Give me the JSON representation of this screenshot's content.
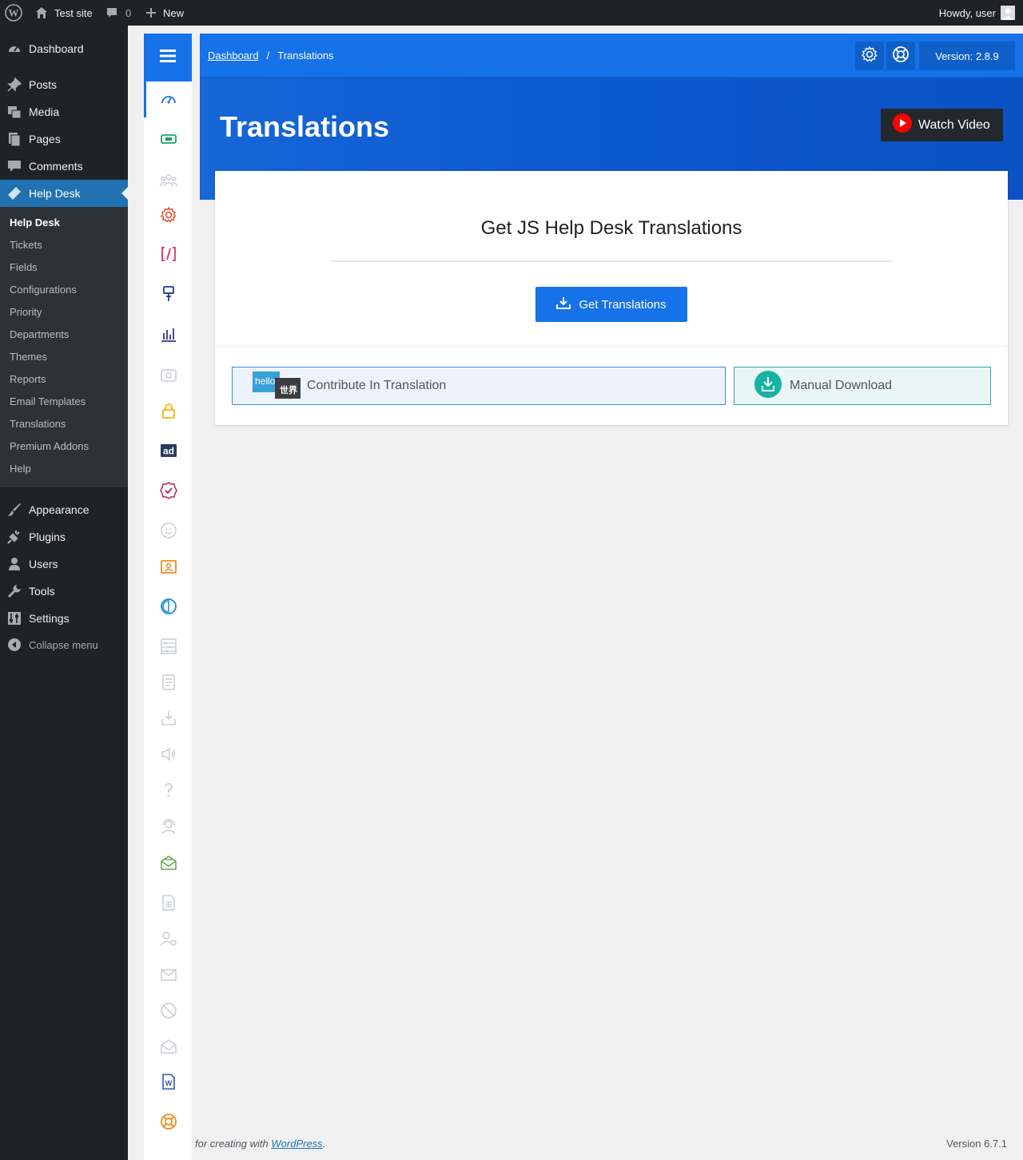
{
  "adminbar": {
    "site_name": "Test site",
    "comments_count": "0",
    "new_label": "New",
    "greeting": "Howdy, user"
  },
  "wp_menu": {
    "items": [
      {
        "label": "Dashboard",
        "icon": "dashboard-icon"
      },
      {
        "label": "Posts",
        "icon": "pin-icon"
      },
      {
        "label": "Media",
        "icon": "media-icon"
      },
      {
        "label": "Pages",
        "icon": "pages-icon"
      },
      {
        "label": "Comments",
        "icon": "comment-icon"
      },
      {
        "label": "Help Desk",
        "icon": "ticket-icon"
      },
      {
        "label": "Appearance",
        "icon": "brush-icon"
      },
      {
        "label": "Plugins",
        "icon": "plug-icon"
      },
      {
        "label": "Users",
        "icon": "user-icon"
      },
      {
        "label": "Tools",
        "icon": "wrench-icon"
      },
      {
        "label": "Settings",
        "icon": "sliders-icon"
      }
    ],
    "submenu": [
      "Help Desk",
      "Tickets",
      "Fields",
      "Configurations",
      "Priority",
      "Departments",
      "Themes",
      "Reports",
      "Email Templates",
      "Translations",
      "Premium Addons",
      "Help"
    ],
    "collapse_label": "Collapse menu"
  },
  "topbar": {
    "crumb_home": "Dashboard",
    "crumb_sep": "/",
    "crumb_current": "Translations",
    "version": "Version: 2.8.9"
  },
  "header": {
    "title": "Translations",
    "watch_video": "Watch Video"
  },
  "card": {
    "heading": "Get JS Help Desk Translations",
    "get_button": "Get Translations",
    "contribute_label": "Contribute In Translation",
    "contribute_logo_top": "hello",
    "contribute_logo_bottom": "世界",
    "manual_label": "Manual Download"
  },
  "footer": {
    "thanks_prefix": "for creating with",
    "wp_link": "WordPress",
    "thanks_suffix": ".",
    "version": "Version 6.7.1"
  },
  "colors": {
    "primary": "#1572e8",
    "admin_dark": "#1d2327",
    "wp_active": "#2271b1"
  }
}
